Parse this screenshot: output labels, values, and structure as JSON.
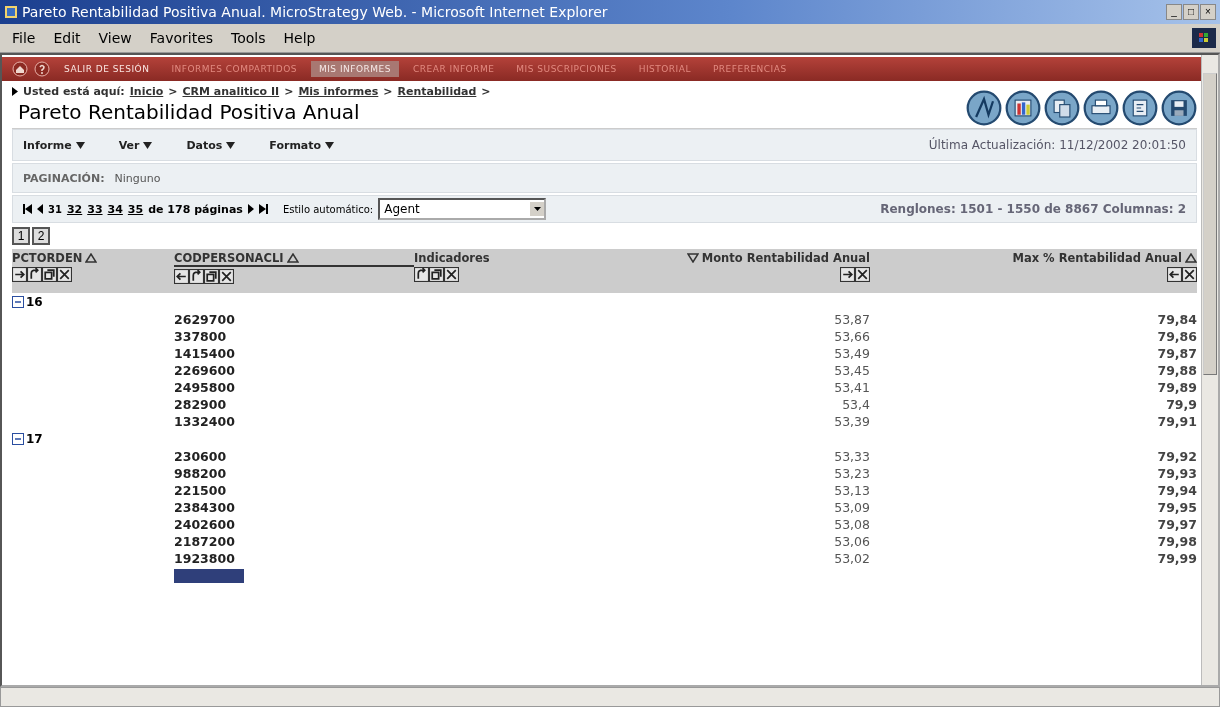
{
  "window": {
    "title": "Pareto Rentabilidad Positiva Anual. MicroStrategy Web. - Microsoft Internet Explorer",
    "controls": [
      "_",
      "□",
      "×"
    ]
  },
  "menu_bar": [
    "File",
    "Edit",
    "View",
    "Favorites",
    "Tools",
    "Help"
  ],
  "nav": [
    {
      "label": "SALIR DE SESIÓN",
      "kind": "action",
      "selected": false
    },
    {
      "label": "INFORMES COMPARTIDOS",
      "kind": "tab",
      "selected": false
    },
    {
      "label": "MIS INFORMES",
      "kind": "tab",
      "selected": true
    },
    {
      "label": "CREAR INFORME",
      "kind": "tab",
      "selected": false
    },
    {
      "label": "MIS SUSCRIPCIONES",
      "kind": "tab",
      "selected": false
    },
    {
      "label": "HISTORIAL",
      "kind": "tab",
      "selected": false
    },
    {
      "label": "PREFERENCIAS",
      "kind": "tab",
      "selected": false
    }
  ],
  "breadcrumb": {
    "prefix": "Usted está aquí:",
    "links": [
      "Inicio",
      "CRM analitico II",
      "Mis informes",
      "Rentabilidad"
    ],
    "separator": ">"
  },
  "report_title": "Pareto Rentabilidad Positiva Anual",
  "report_menus": [
    "Informe",
    "Ver",
    "Datos",
    "Formato"
  ],
  "last_update": "Última Actualización: 11/12/2002 20:01:50",
  "pagination": {
    "label": "PAGINACIÓN:",
    "value": "Ninguno"
  },
  "pager": {
    "current": "31",
    "pages": [
      "32",
      "33",
      "34",
      "35"
    ],
    "total": "de 178 páginas",
    "style_label": "Estilo automático:",
    "style_value": "Agent",
    "rows_info": "Renglones: 1501 - 1550 de 8867  Columnas: 2"
  },
  "levels": [
    "1",
    "2"
  ],
  "table": {
    "columns": [
      {
        "label": "PCTORDEN",
        "kind": "attribute",
        "sorted": true,
        "descending": false
      },
      {
        "label": "CODPERSONACLI",
        "kind": "attribute",
        "sorted": true,
        "descending": false
      },
      {
        "label": "Indicadores",
        "kind": "metrics",
        "sorted": false
      },
      {
        "label": "Monto Rentabilidad Anual",
        "kind": "metric",
        "sorted": true,
        "descending": true
      },
      {
        "label": "Max % Rentabilidad Anual",
        "kind": "metric",
        "sorted": true,
        "descending": false
      }
    ],
    "groups": [
      {
        "label": "16",
        "expanded": true,
        "rows": [
          {
            "code": "2629700",
            "monto": "53,87",
            "max": "79,84"
          },
          {
            "code": "337800",
            "monto": "53,66",
            "max": "79,86"
          },
          {
            "code": "1415400",
            "monto": "53,49",
            "max": "79,87"
          },
          {
            "code": "2269600",
            "monto": "53,45",
            "max": "79,88"
          },
          {
            "code": "2495800",
            "monto": "53,41",
            "max": "79,89"
          },
          {
            "code": "282900",
            "monto": "53,4",
            "max": "79,9"
          },
          {
            "code": "1332400",
            "monto": "53,39",
            "max": "79,91"
          }
        ]
      },
      {
        "label": "17",
        "expanded": true,
        "rows": [
          {
            "code": "230600",
            "monto": "53,33",
            "max": "79,92"
          },
          {
            "code": "988200",
            "monto": "53,23",
            "max": "79,93"
          },
          {
            "code": "221500",
            "monto": "53,13",
            "max": "79,94"
          },
          {
            "code": "2384300",
            "monto": "53,09",
            "max": "79,95"
          },
          {
            "code": "2402600",
            "monto": "53,08",
            "max": "79,97"
          },
          {
            "code": "2187200",
            "monto": "53,06",
            "max": "79,98"
          },
          {
            "code": "1923800",
            "monto": "53,02",
            "max": "79,99"
          }
        ]
      }
    ]
  }
}
